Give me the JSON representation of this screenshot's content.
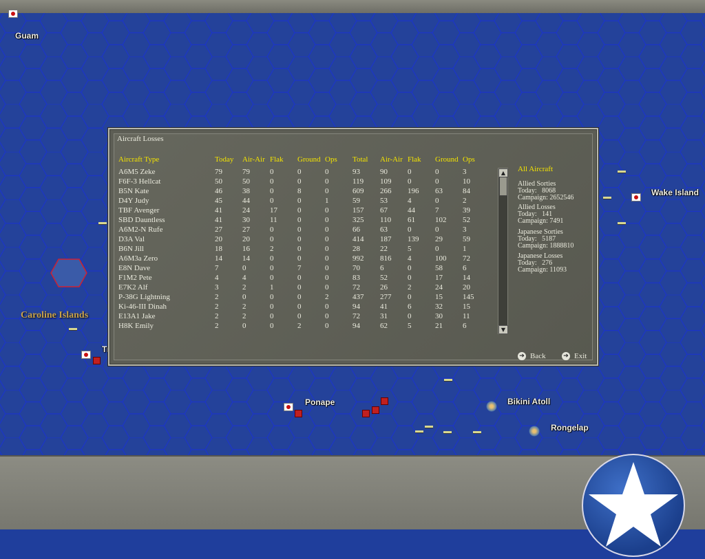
{
  "map": {
    "labels": {
      "guam": "Guam",
      "wake": "Wake Island",
      "ponape": "Ponape",
      "bikini": "Bikini Atoll",
      "rongelap": "Rongelap",
      "truk_partial": "Tr"
    },
    "region": "Caroline Islands",
    "hex_color": "#1e3aaa",
    "sea_color": "#21409e"
  },
  "dialog": {
    "title": "Aircraft Losses",
    "headers": {
      "type": "Aircraft Type",
      "today": "Today",
      "air1": "Air-Air",
      "flak1": "Flak",
      "ground1": "Ground",
      "ops1": "Ops",
      "total": "Total",
      "air2": "Air-Air",
      "flak2": "Flak",
      "ground2": "Ground",
      "ops2": "Ops"
    },
    "rows": [
      [
        "A6M5 Zeke",
        "79",
        "79",
        "0",
        "0",
        "0",
        "93",
        "90",
        "0",
        "0",
        "3"
      ],
      [
        "F6F-3 Hellcat",
        "50",
        "50",
        "0",
        "0",
        "0",
        "119",
        "109",
        "0",
        "0",
        "10"
      ],
      [
        "B5N Kate",
        "46",
        "38",
        "0",
        "8",
        "0",
        "609",
        "266",
        "196",
        "63",
        "84"
      ],
      [
        "D4Y Judy",
        "45",
        "44",
        "0",
        "0",
        "1",
        "59",
        "53",
        "4",
        "0",
        "2"
      ],
      [
        "TBF Avenger",
        "41",
        "24",
        "17",
        "0",
        "0",
        "157",
        "67",
        "44",
        "7",
        "39"
      ],
      [
        "SBD Dauntless",
        "41",
        "30",
        "11",
        "0",
        "0",
        "325",
        "110",
        "61",
        "102",
        "52"
      ],
      [
        "A6M2-N Rufe",
        "27",
        "27",
        "0",
        "0",
        "0",
        "66",
        "63",
        "0",
        "0",
        "3"
      ],
      [
        "D3A Val",
        "20",
        "20",
        "0",
        "0",
        "0",
        "414",
        "187",
        "139",
        "29",
        "59"
      ],
      [
        "B6N Jill",
        "18",
        "16",
        "2",
        "0",
        "0",
        "28",
        "22",
        "5",
        "0",
        "1"
      ],
      [
        "A6M3a Zero",
        "14",
        "14",
        "0",
        "0",
        "0",
        "992",
        "816",
        "4",
        "100",
        "72"
      ],
      [
        "E8N Dave",
        "7",
        "0",
        "0",
        "7",
        "0",
        "70",
        "6",
        "0",
        "58",
        "6"
      ],
      [
        "F1M2 Pete",
        "4",
        "4",
        "0",
        "0",
        "0",
        "83",
        "52",
        "0",
        "17",
        "14"
      ],
      [
        "E7K2 Alf",
        "3",
        "2",
        "1",
        "0",
        "0",
        "72",
        "26",
        "2",
        "24",
        "20"
      ],
      [
        "P-38G Lightning",
        "2",
        "0",
        "0",
        "0",
        "2",
        "437",
        "277",
        "0",
        "15",
        "145"
      ],
      [
        "Ki-46-III Dinah",
        "2",
        "2",
        "0",
        "0",
        "0",
        "94",
        "41",
        "6",
        "32",
        "15"
      ],
      [
        "E13A1 Jake",
        "2",
        "2",
        "0",
        "0",
        "0",
        "72",
        "31",
        "0",
        "30",
        "11"
      ],
      [
        "H8K Emily",
        "2",
        "0",
        "0",
        "2",
        "0",
        "94",
        "62",
        "5",
        "21",
        "6"
      ]
    ],
    "side": {
      "title": "All Aircraft",
      "allied_sorties": "Allied Sorties",
      "allied_sorties_today": "Today:   8068",
      "allied_sorties_campaign": "Campaign: 2652546",
      "allied_losses": "Allied Losses",
      "allied_losses_today": "Today:   141",
      "allied_losses_campaign": "Campaign: 7491",
      "japanese_sorties": "Japanese Sorties",
      "japanese_sorties_today": "Today:   5187",
      "japanese_sorties_campaign": "Campaign: 1888810",
      "japanese_losses": "Japanese Losses",
      "japanese_losses_today": "Today:   276",
      "japanese_losses_campaign": "Campaign: 11093"
    },
    "buttons": {
      "back": "Back",
      "exit": "Exit"
    }
  },
  "colors": {
    "header": "#f4e400",
    "panel": "#5d5e55",
    "text": "#ececdf"
  }
}
